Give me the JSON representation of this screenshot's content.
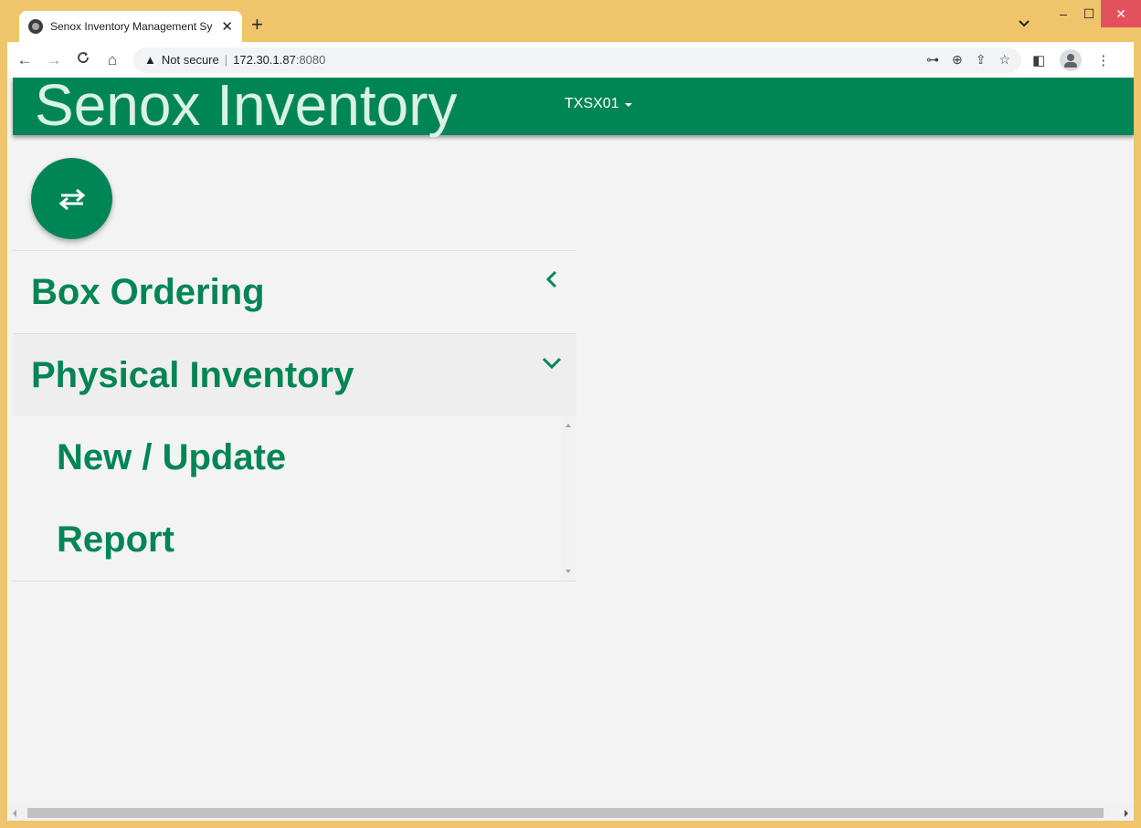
{
  "browser": {
    "tab_title": "Senox Inventory Management Sy",
    "tab_close": "✕",
    "new_tab": "+",
    "tab_search": "⌄",
    "window_minimize": "–",
    "window_maximize": "☐",
    "window_close": "✕",
    "nav_back": "←",
    "nav_forward": "→",
    "nav_reload": "C",
    "nav_home": "⌂",
    "security_warning": "▲",
    "security_label": "Not secure",
    "separator": "|",
    "url_host": "172.30.1.87",
    "url_port": ":8080",
    "icons": {
      "password_key": "⊶",
      "zoom": "⊕",
      "share": "⇪",
      "bookmark": "☆",
      "side_panel": "◧",
      "menu": "⋮"
    }
  },
  "app": {
    "title": "Senox Inventory",
    "site_selector": "TXSX01",
    "brand_color": "#008556",
    "title_color": "#d9f2e6"
  },
  "menu": {
    "items": [
      {
        "label": "Box Ordering",
        "state": "collapsed",
        "chevron": "chevron-left-icon"
      },
      {
        "label": "Physical Inventory",
        "state": "expanded",
        "chevron": "chevron-down-icon",
        "subitems": [
          {
            "label": "New / Update"
          },
          {
            "label": "Report"
          }
        ]
      }
    ]
  },
  "fab": {
    "icon": "swap-arrows-icon"
  }
}
